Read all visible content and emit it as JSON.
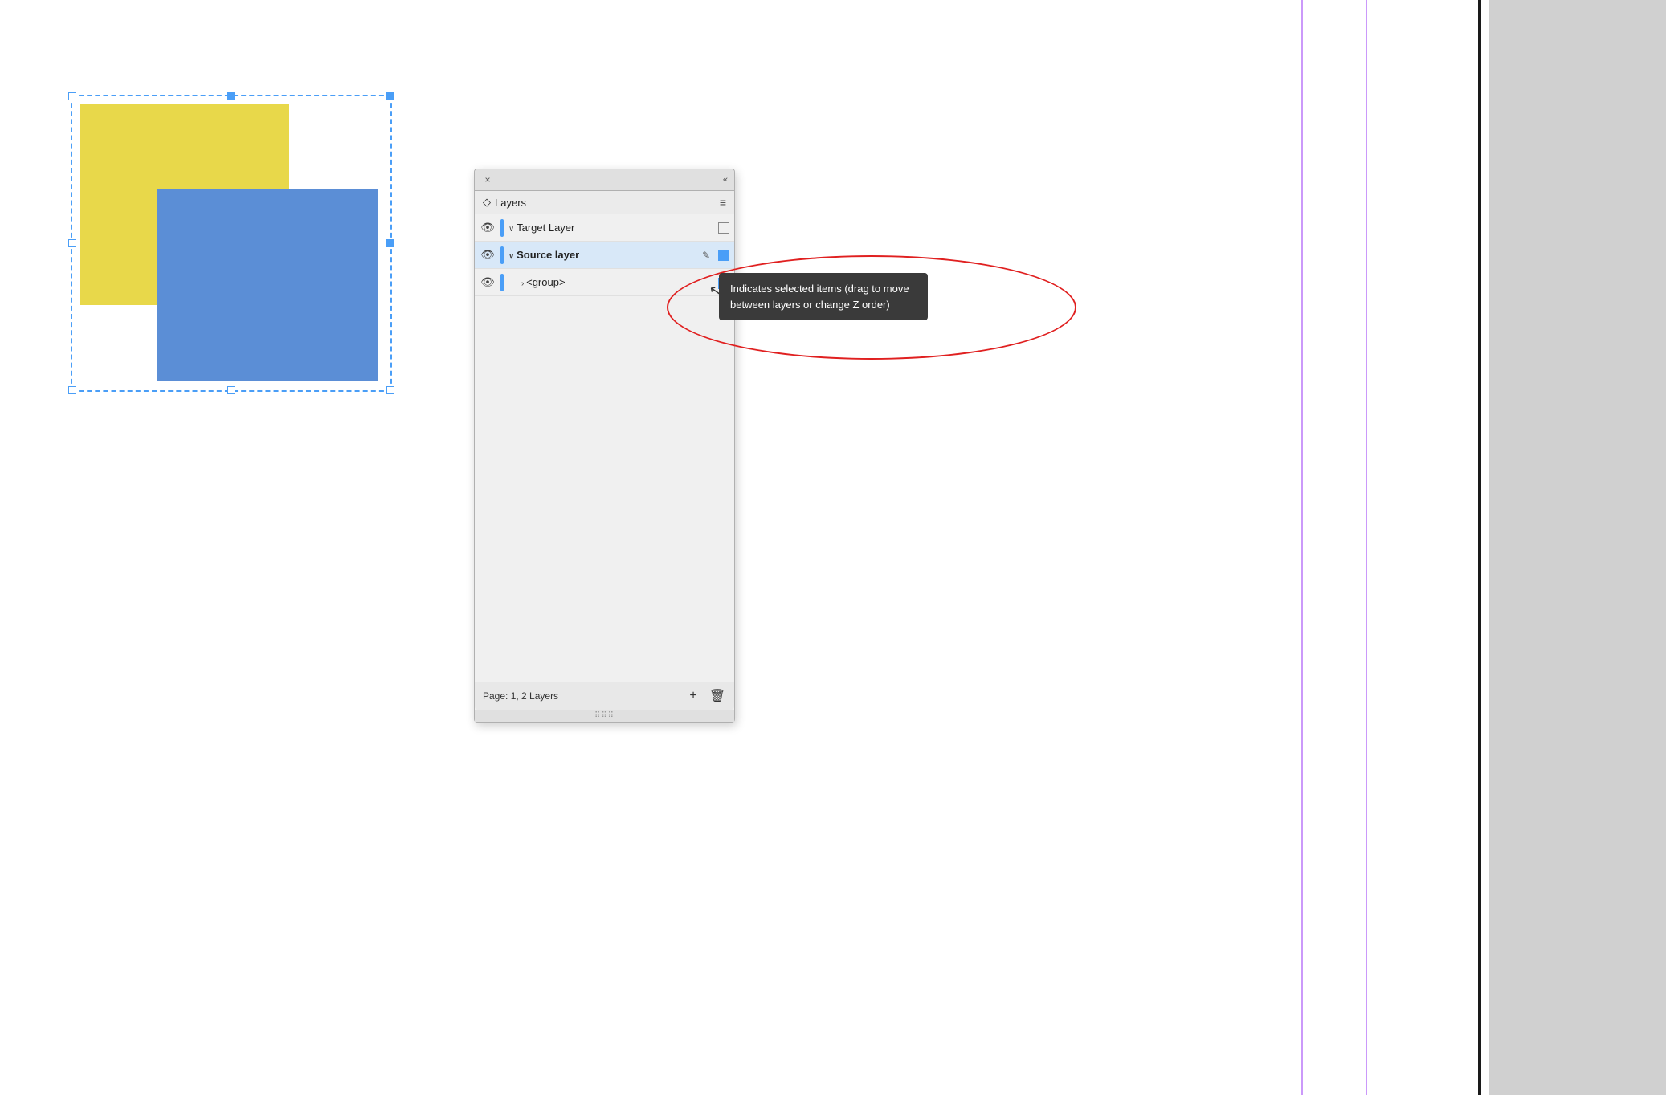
{
  "canvas": {
    "background": "#ffffff"
  },
  "panel": {
    "title": "Layers",
    "title_icon": "◇",
    "close_label": "×",
    "collapse_label": "«",
    "menu_label": "≡",
    "layers": [
      {
        "id": "target-layer",
        "name": "Target Layer",
        "color": "#4a9ef7",
        "visible": true,
        "expanded": true,
        "selected": false,
        "bold": false,
        "indent": 0,
        "has_checkbox": true,
        "has_pencil": false
      },
      {
        "id": "source-layer",
        "name": "Source layer",
        "color": "#4a9ef7",
        "visible": true,
        "expanded": true,
        "selected": true,
        "bold": true,
        "indent": 0,
        "has_checkbox": true,
        "has_pencil": true
      },
      {
        "id": "group-layer",
        "name": "<group>",
        "color": "#4a9ef7",
        "visible": true,
        "expanded": false,
        "selected": false,
        "bold": false,
        "indent": 1,
        "has_checkbox": true,
        "has_pencil": false
      }
    ],
    "footer": {
      "page_label": "Page: 1, 2 Layers",
      "add_button": "+",
      "delete_button": "🗑"
    }
  },
  "tooltip": {
    "text": "Indicates selected items (drag to move between layers or change Z order)"
  }
}
